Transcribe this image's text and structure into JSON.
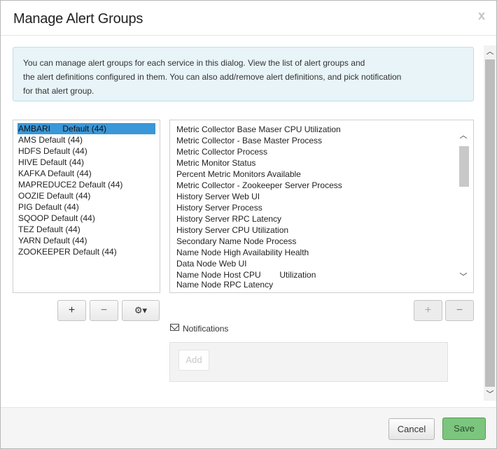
{
  "dialog": {
    "title": "Manage Alert Groups",
    "close_glyph": "x"
  },
  "info": {
    "lines": [
      "You can manage alert groups for each service in this dialog. View the list of alert groups and",
      "the alert definitions configured in them. You can also add/remove alert definitions, and pick notification",
      "for that alert group."
    ]
  },
  "groups": [
    {
      "name": "AMBARI",
      "suffix": "Default (44)",
      "selected": true
    },
    {
      "name": "AMS Default (44)"
    },
    {
      "name": "HDFS Default (44)"
    },
    {
      "name": "HIVE Default (44)"
    },
    {
      "name": "KAFKA Default (44)"
    },
    {
      "name": "MAPREDUCE2 Default (44)"
    },
    {
      "name": "OOZIE Default (44)"
    },
    {
      "name": "PIG Default (44)"
    },
    {
      "name": "SQOOP Default (44)"
    },
    {
      "name": "TEZ Default (44)"
    },
    {
      "name": "YARN Default (44)"
    },
    {
      "name": "ZOOKEEPER Default (44)"
    }
  ],
  "definitions": [
    "Metric Collector Base Maser CPU Utilization",
    "Metric Collector - Base Master Process",
    "Metric Collector Process",
    "Metric Monitor Status",
    "Percent Metric Monitors Available",
    "Metric Collector - Zookeeper Server Process",
    "History Server Web UI",
    "History Server Process",
    "History Server RPC Latency",
    "History Server CPU Utilization",
    "Secondary Name Node Process",
    "Name Node High Availability Health",
    "Data Node Web UI",
    "Name Node Host CPU        Utilization",
    "Name Node RPC Latency"
  ],
  "buttons": {
    "add": "+",
    "remove": "−",
    "settings": "⚙▾",
    "def_add": "+",
    "def_remove": "−"
  },
  "notifications": {
    "label": "Notifications",
    "add_placeholder": "Add"
  },
  "footer": {
    "cancel": "Cancel",
    "save": "Save"
  },
  "colors": {
    "selected_bg": "#3a97d8",
    "save_bg": "#7cc57e",
    "info_bg": "#e8f4f8"
  }
}
